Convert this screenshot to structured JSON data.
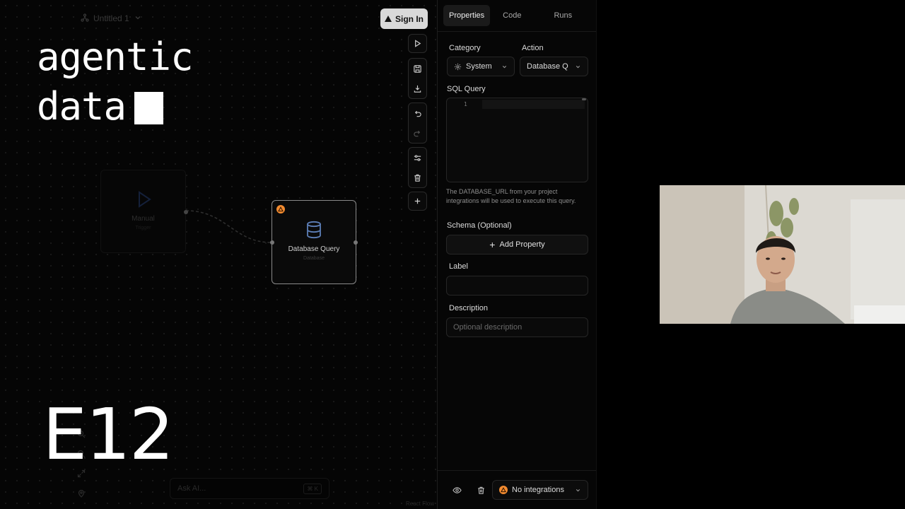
{
  "brand": {
    "line1": "agentic",
    "line2": "data"
  },
  "episode": "E12",
  "canvas": {
    "project_name": "Untitled 1",
    "sign_in_label": "Sign In",
    "nodes": {
      "manual": {
        "title": "Manual",
        "subtitle": "Trigger"
      },
      "database": {
        "title": "Database Query",
        "subtitle": "Database"
      }
    },
    "ask_ai": {
      "placeholder": "Ask AI...",
      "shortcut": "⌘ K"
    },
    "attribution": "React Flow"
  },
  "panel": {
    "tabs": [
      {
        "label": "Properties",
        "active": true
      },
      {
        "label": "Code",
        "active": false
      },
      {
        "label": "Runs",
        "active": false
      }
    ],
    "category": {
      "label": "Category",
      "value": "System"
    },
    "action": {
      "label": "Action",
      "value": "Database Q"
    },
    "sql": {
      "label": "SQL Query",
      "line_number": "1"
    },
    "help_text": "The DATABASE_URL from your project integrations will be used to execute this query.",
    "schema": {
      "label": "Schema (Optional)",
      "add_button": "Add Property"
    },
    "label_field": {
      "label": "Label",
      "value": ""
    },
    "description_field": {
      "label": "Description",
      "placeholder": "Optional description"
    },
    "integrations": {
      "value": "No integrations"
    }
  },
  "colors": {
    "accent_warning": "#f28b30",
    "sign_in_bg": "#d9d9d9"
  }
}
